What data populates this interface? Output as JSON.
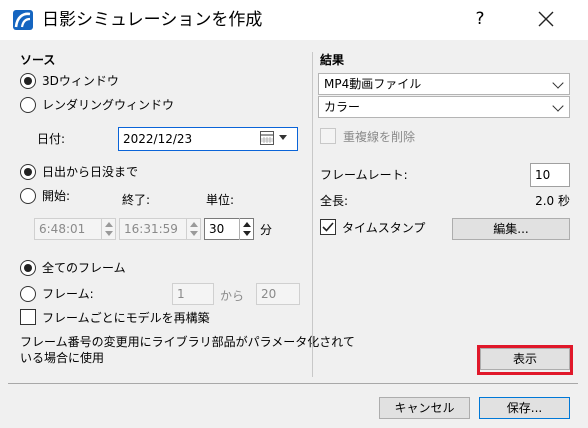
{
  "window": {
    "title": "日影シミュレーションを作成",
    "help_label": "?"
  },
  "source": {
    "heading": "ソース",
    "option_3d": "3Dウィンドウ",
    "option_rendering": "レンダリングウィンドウ",
    "date_label": "日付:",
    "date_value": "2022/12/23",
    "option_sunrise_sunset": "日出から日没まで",
    "option_start": "開始:",
    "end_label": "終了:",
    "unit_label": "単位:",
    "start_time": "6:48:01",
    "end_time": "16:31:59",
    "interval_value": "30",
    "interval_unit": "分",
    "option_all_frames": "全てのフレーム",
    "option_frames": "フレーム:",
    "frame_from": "1",
    "from_label": "から",
    "frame_to": "20",
    "rebuild_label": "フレームごとにモデルを再構築",
    "note": [
      "フレーム番号の変更用にライブラリ部品がパラメータ化されて",
      "いる場合に使用"
    ]
  },
  "result": {
    "heading": "結果",
    "format": "MP4動画ファイル",
    "color_mode": "カラー",
    "remove_duplicate_lines": "重複線を削除",
    "framerate_label": "フレームレート:",
    "framerate_value": "10",
    "length_label": "全長:",
    "length_value": "2.0 秒",
    "timestamp_label": "タイムスタンプ",
    "edit_button": "編集...",
    "show_button": "表示"
  },
  "footer": {
    "cancel": "キャンセル",
    "save": "保存..."
  },
  "colors": {
    "highlight": "#e0182a",
    "app_icon": "#1565c0"
  }
}
